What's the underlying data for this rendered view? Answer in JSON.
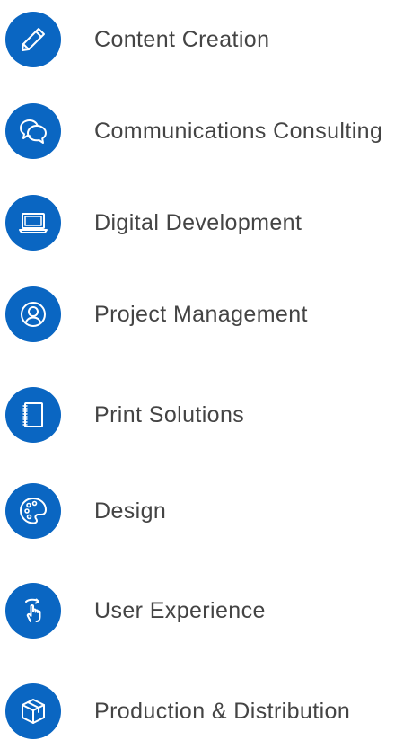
{
  "colors": {
    "icon_circle": "#0a66c2",
    "icon_stroke": "#ffffff",
    "label_text": "#444444",
    "background": "#ffffff"
  },
  "services": [
    {
      "label": "Content Creation",
      "icon": "pencil-icon"
    },
    {
      "label": "Communications Consulting",
      "icon": "chat-bubbles-icon"
    },
    {
      "label": "Digital Development",
      "icon": "laptop-icon"
    },
    {
      "label": "Project Management",
      "icon": "user-circle-icon"
    },
    {
      "label": "Print Solutions",
      "icon": "notebook-icon"
    },
    {
      "label": "Design",
      "icon": "palette-icon"
    },
    {
      "label": "User Experience",
      "icon": "tap-hand-icon"
    },
    {
      "label": "Production & Distribution",
      "icon": "package-box-icon"
    }
  ]
}
